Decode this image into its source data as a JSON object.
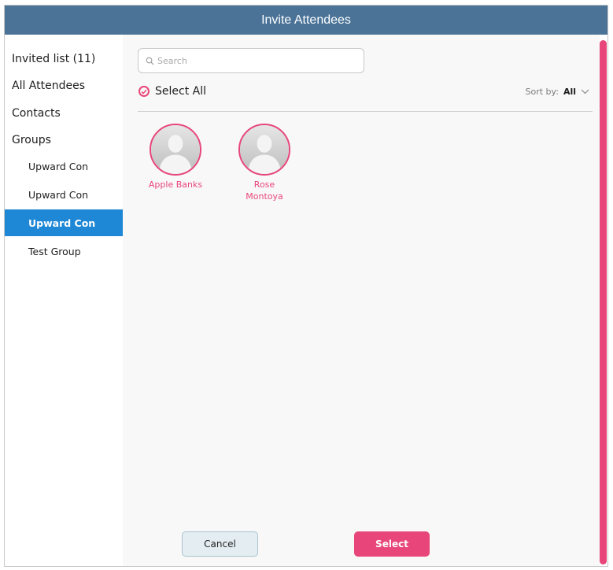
{
  "dialog": {
    "title": "Invite Attendees"
  },
  "sidebar": {
    "items": [
      {
        "label": "Invited list (11)"
      },
      {
        "label": "All Attendees"
      },
      {
        "label": "Contacts"
      },
      {
        "label": "Groups"
      }
    ],
    "groups": [
      {
        "label": "Upward Con"
      },
      {
        "label": "Upward Con"
      },
      {
        "label": "Upward Con",
        "active": true
      },
      {
        "label": "Test Group"
      }
    ]
  },
  "search": {
    "placeholder": "Search",
    "value": ""
  },
  "select_all": {
    "label": "Select All",
    "checked": true
  },
  "sort": {
    "label": "Sort by:",
    "value": "All"
  },
  "contacts": [
    {
      "name": "Apple Banks"
    },
    {
      "name": "Rose Montoya"
    }
  ],
  "buttons": {
    "cancel": "Cancel",
    "select": "Select"
  },
  "colors": {
    "titlebar": "#4a7397",
    "accent": "#e8467a",
    "active_group": "#1e88d6"
  },
  "icons": [
    "search-icon",
    "check-circle-icon",
    "chevron-down-icon",
    "avatar-placeholder-icon"
  ]
}
